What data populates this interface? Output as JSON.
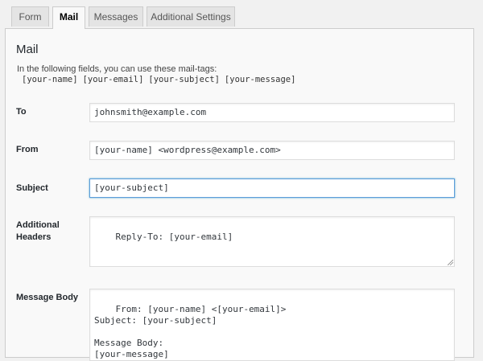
{
  "tabs": [
    {
      "label": "Form"
    },
    {
      "label": "Mail"
    },
    {
      "label": "Messages"
    },
    {
      "label": "Additional Settings"
    }
  ],
  "mail": {
    "title": "Mail",
    "description": "In the following fields, you can use these mail-tags:",
    "tags": [
      "[your-name]",
      "[your-email]",
      "[your-subject]",
      "[your-message]"
    ],
    "to": {
      "label": "To",
      "value": "johnsmith@example.com"
    },
    "from": {
      "label": "From",
      "value": "[your-name] <wordpress@example.com>"
    },
    "subject": {
      "label": "Subject",
      "value": "[your-subject]"
    },
    "additional_headers": {
      "label_line1": "Additional",
      "label_line2": "Headers",
      "value": "Reply-To: [your-email]"
    },
    "message_body": {
      "label": "Message Body",
      "value": "From: [your-name] <[your-email]>\nSubject: [your-subject]\n\nMessage Body:\n[your-message]"
    }
  }
}
